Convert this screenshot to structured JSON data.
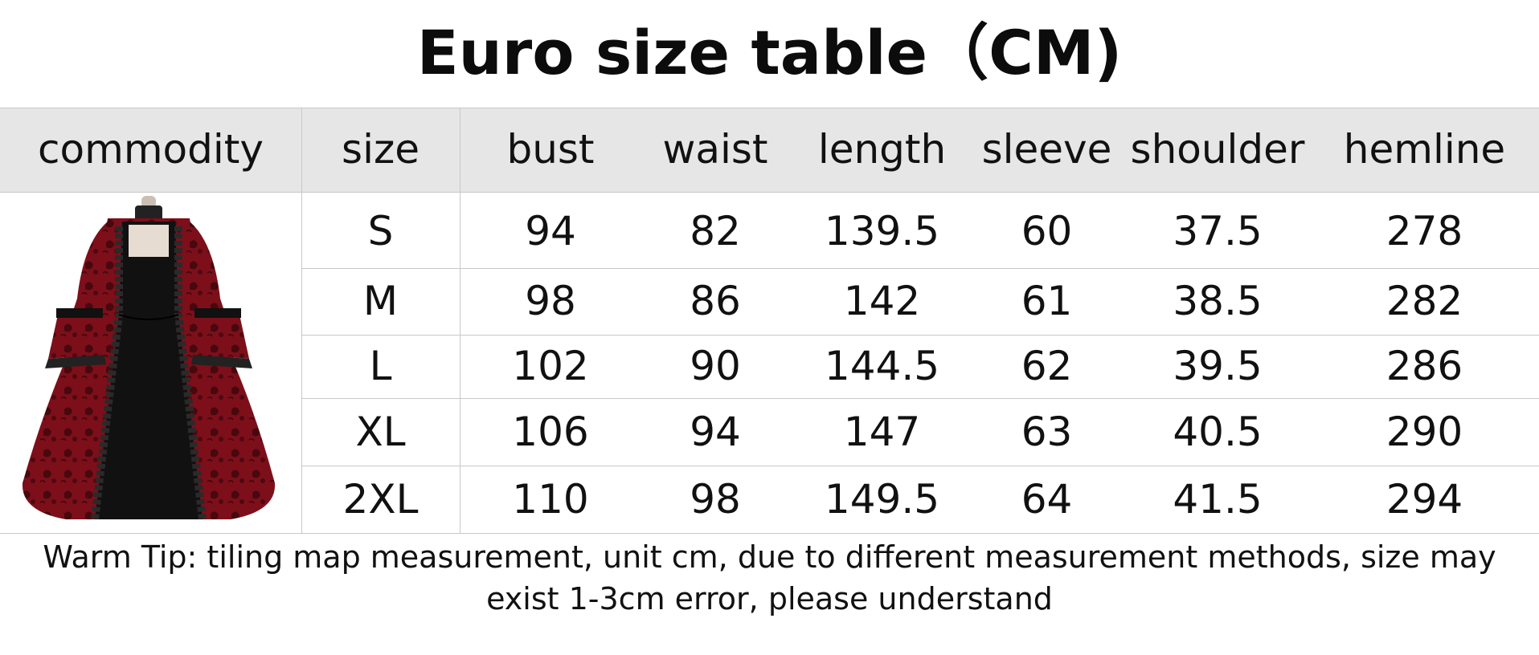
{
  "title": "Euro size table（CM)",
  "table": {
    "headers": [
      "commodity",
      "size",
      "bust",
      "waist",
      "length",
      "sleeve",
      "shoulder",
      "hemline"
    ],
    "rows": [
      [
        "S",
        "94",
        "82",
        "139.5",
        "60",
        "37.5",
        "278"
      ],
      [
        "M",
        "98",
        "86",
        "142",
        "61",
        "38.5",
        "282"
      ],
      [
        "L",
        "102",
        "90",
        "144.5",
        "62",
        "39.5",
        "286"
      ],
      [
        "XL",
        "106",
        "94",
        "147",
        "63",
        "40.5",
        "290"
      ],
      [
        "2XL",
        "110",
        "98",
        "149.5",
        "64",
        "41.5",
        "294"
      ]
    ]
  },
  "tip_lines": [
    "Warm Tip: tiling map measurement, unit cm, due to different measurement methods, size may",
    "exist 1-3cm error, please understand"
  ],
  "colors": {
    "header_bg": "#e6e6e6",
    "grid": "#c8c8c8",
    "dress_red": "#7d0f1a",
    "dress_black": "#111111"
  },
  "product_image": "victorian-ball-gown-photo"
}
